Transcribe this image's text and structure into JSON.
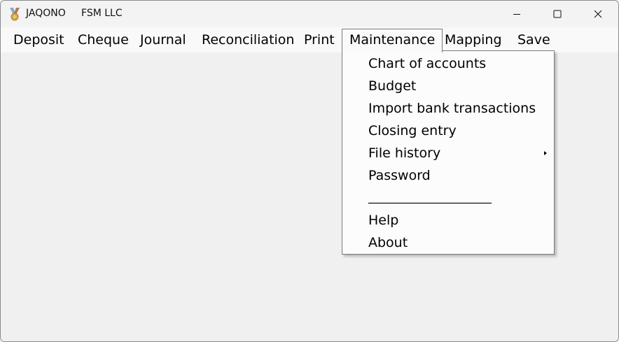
{
  "window": {
    "app_name": "JAQONO",
    "company": "FSM LLC",
    "icon": "medal-icon"
  },
  "caption_buttons": {
    "minimize": "minimize-icon",
    "maximize": "maximize-icon",
    "close": "close-icon"
  },
  "menubar": {
    "items": [
      "Deposit",
      "Cheque",
      "Journal",
      "Reconciliation",
      "Print",
      "Maintenance",
      "Mapping",
      "Save"
    ],
    "open_item": "Maintenance"
  },
  "dropdown": {
    "items": [
      {
        "label": "Chart of accounts"
      },
      {
        "label": "Budget"
      },
      {
        "label": "Import bank transactions"
      },
      {
        "label": "Closing entry"
      },
      {
        "label": "File history",
        "has_submenu": true
      },
      {
        "label": "Password"
      },
      {
        "label": "______________________"
      },
      {
        "label": "Help"
      },
      {
        "label": "About"
      }
    ]
  },
  "colors": {
    "background": "#f0f0f0",
    "menu_background": "#f9f9f9",
    "dropdown_background": "#fcfcfc",
    "border": "#7a7a7a"
  }
}
